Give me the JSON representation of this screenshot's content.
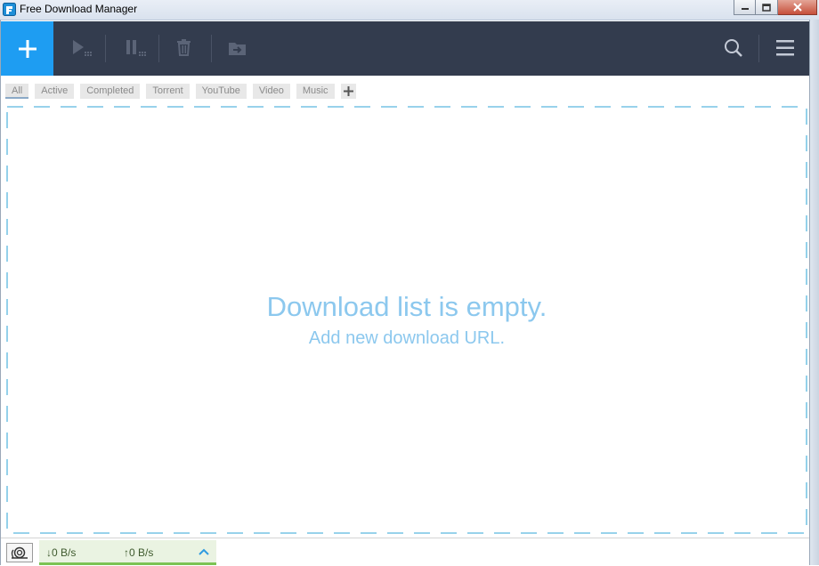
{
  "window": {
    "title": "Free Download Manager",
    "buttons": [
      "minimize",
      "maximize",
      "close"
    ]
  },
  "toolbar": {
    "add": {
      "icon": "plus-icon"
    },
    "actions": [
      {
        "name": "start",
        "icon": "play-icon",
        "enabled": false
      },
      {
        "name": "pause",
        "icon": "pause-icon",
        "enabled": false
      },
      {
        "name": "delete",
        "icon": "trash-icon",
        "enabled": false
      },
      {
        "name": "move",
        "icon": "folder-move-icon",
        "enabled": false
      }
    ],
    "search_icon": "search-icon",
    "menu_icon": "hamburger-menu-icon"
  },
  "tabs": [
    {
      "label": "All",
      "selected": true
    },
    {
      "label": "Active",
      "selected": false
    },
    {
      "label": "Completed",
      "selected": false
    },
    {
      "label": "Torrent",
      "selected": false
    },
    {
      "label": "YouTube",
      "selected": false
    },
    {
      "label": "Video",
      "selected": false
    },
    {
      "label": "Music",
      "selected": false
    }
  ],
  "empty_state": {
    "title": "Download list is empty.",
    "subtitle": "Add new download URL."
  },
  "status": {
    "download_speed": "0 B/s",
    "upload_speed": "0 B/s",
    "snail_icon": "snail-icon",
    "expand_icon": "chevron-up-icon"
  },
  "colors": {
    "toolbar_bg": "#333c4e",
    "accent": "#1e9df2",
    "empty_text": "#8cc8ee",
    "speed_bar": "#7cc354"
  }
}
